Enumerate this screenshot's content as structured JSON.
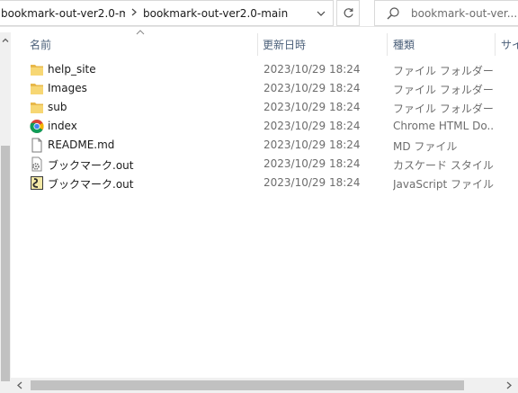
{
  "address_bar": {
    "crumbs": [
      "bookmark-out-ver2.0-m...",
      "bookmark-out-ver2.0-main"
    ],
    "search_placeholder": "bookmark-out-ver..."
  },
  "columns": {
    "name": "名前",
    "date": "更新日時",
    "type": "種類",
    "size": "サイ"
  },
  "files": [
    {
      "name": "help_site",
      "date": "2023/10/29 18:24",
      "type": "ファイル フォルダー",
      "icon": "folder-icon"
    },
    {
      "name": "Images",
      "date": "2023/10/29 18:24",
      "type": "ファイル フォルダー",
      "icon": "folder-icon"
    },
    {
      "name": "sub",
      "date": "2023/10/29 18:24",
      "type": "ファイル フォルダー",
      "icon": "folder-icon"
    },
    {
      "name": "index",
      "date": "2023/10/29 18:24",
      "type": "Chrome HTML Do...",
      "icon": "chrome-icon"
    },
    {
      "name": "README.md",
      "date": "2023/10/29 18:24",
      "type": "MD ファイル",
      "icon": "document-icon"
    },
    {
      "name": "ブックマーク.out",
      "date": "2023/10/29 18:24",
      "type": "カスケード スタイル シ...",
      "icon": "gear-document-icon"
    },
    {
      "name": "ブックマーク.out",
      "date": "2023/10/29 18:24",
      "type": "JavaScript ファイル",
      "icon": "script-icon"
    }
  ],
  "colors": {
    "folder": "#f7d774",
    "header_text": "#4c607a",
    "secondary_text": "#6d6d6d",
    "scrollbar_thumb": "#c1c1c1"
  }
}
